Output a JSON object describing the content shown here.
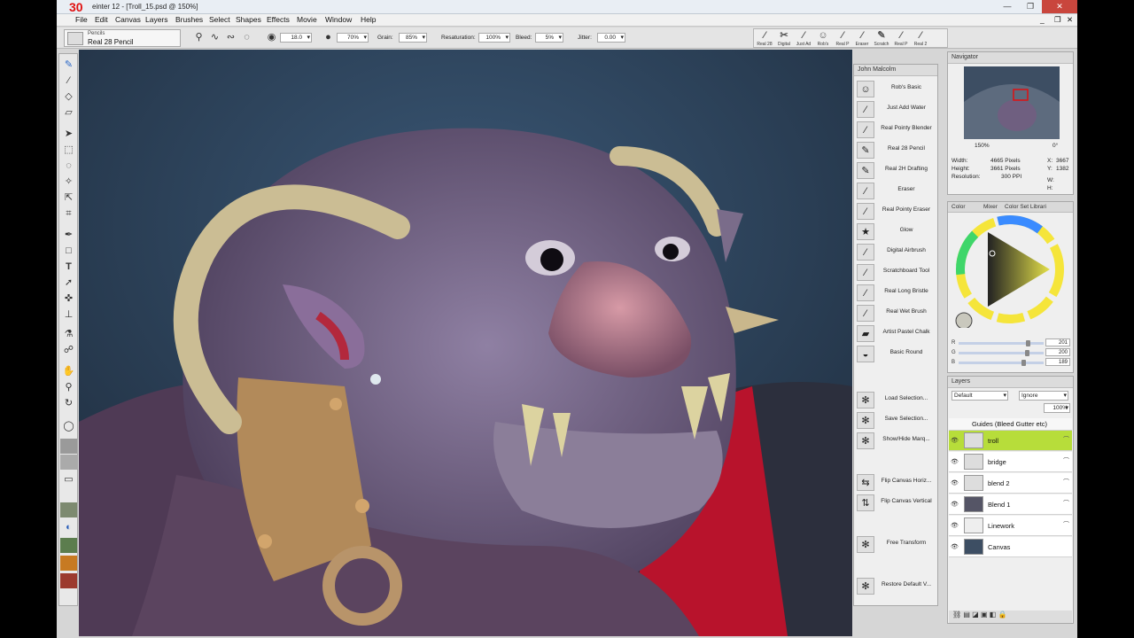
{
  "title": "einter 12 - [Troll_15.psd @ 150%]",
  "badge": "30",
  "window_controls": {
    "min": "—",
    "max": "❐",
    "close": "✕"
  },
  "doc_controls": {
    "min": "_",
    "restore": "❐",
    "close": "✕"
  },
  "menu": [
    "File",
    "Edit",
    "Canvas",
    "Layers",
    "Brushes",
    "Select",
    "Shapes",
    "Effects",
    "Movie",
    "Window",
    "Help"
  ],
  "brush": {
    "category": "Pencils",
    "variant": "Real 28 Pencil"
  },
  "toolbar": {
    "size": "18.0",
    "opacity": "70%",
    "grain_label": "Grain:",
    "grain": "85%",
    "resat_label": "Resaturation:",
    "resat": "100%",
    "bleed_label": "Bleed:",
    "bleed": "5%",
    "jitter_label": "Jitter:",
    "jitter": "0.00"
  },
  "recent_brushes": [
    "Real 28",
    "Digital",
    "Just Ad",
    "Rob's",
    "Real P",
    "Eraser",
    "Scratch",
    "Real P",
    "Real 2"
  ],
  "custom_panel": {
    "title": "John Malcolm",
    "brushes": [
      "Rob's Basic",
      "Just Add Water",
      "Real Pointy Blender",
      "Real 28 Pencil",
      "Real 2H Drafting",
      "Eraser",
      "Real Pointy Eraser",
      "Glow",
      "Digital Airbrush",
      "Scratchboard Tool",
      "Real Long Bristle",
      "Real Wet Brush",
      "Artist Pastel Chalk",
      "Basic Round"
    ],
    "commands": [
      "Load Selection...",
      "Save Selection...",
      "Show/Hide Marq...",
      "Flip Canvas Horiz...",
      "Flip Canvas Vertical",
      "Free Transform",
      "Restore Default V..."
    ]
  },
  "navigator": {
    "title": "Navigator",
    "zoom": "150%",
    "angle": "0°",
    "width_label": "Width:",
    "width": "4665 Pixels",
    "height_label": "Height:",
    "height": "3661 Pixels",
    "res_label": "Resolution:",
    "res": "300 PPI",
    "x_label": "X:",
    "x": "3667",
    "y_label": "Y:",
    "y": "1382",
    "w_label": "W:",
    "h_label": "H:"
  },
  "color": {
    "tabs": [
      "Color",
      "Mixer",
      "Color Set Librari"
    ],
    "r_label": "R",
    "g_label": "G",
    "b_label": "B",
    "r": "201",
    "g": "200",
    "b": "189",
    "r_frac": 0.79,
    "g_frac": 0.78,
    "b_frac": 0.74,
    "main_color": "#c9c8bd"
  },
  "layers": {
    "title": "Layers",
    "blend": "Default",
    "composite": "Ignore",
    "opacity": "100%",
    "group": "Guides (Bleed Gutter etc)",
    "items": [
      "troll",
      "bridge",
      "blend 2",
      "Blend 1",
      "Linework",
      "Canvas"
    ]
  }
}
